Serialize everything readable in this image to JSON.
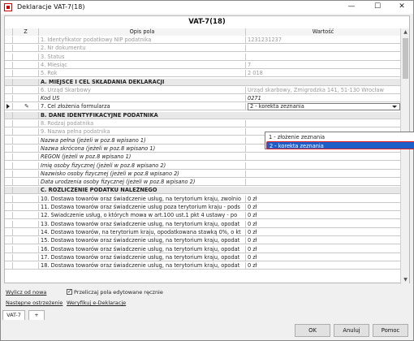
{
  "window": {
    "title": "Deklaracje VAT-7(18)",
    "minimize_label": "—",
    "maximize_label": "☐",
    "close_label": "✕"
  },
  "form": {
    "title": "VAT-7(18)"
  },
  "columns": {
    "z": "Z",
    "description": "Opis pola",
    "value": "Wartość"
  },
  "rows": [
    {
      "kind": "field",
      "label": "1. Identyfikator podatkowy NIP podatnika",
      "value": "1231231237",
      "style": "disabled"
    },
    {
      "kind": "field",
      "label": "2. Nr dokumentu",
      "value": "",
      "style": "disabled"
    },
    {
      "kind": "field",
      "label": "3. Status",
      "value": "",
      "style": "disabled"
    },
    {
      "kind": "field",
      "label": "4. Miesiąc",
      "value": "7",
      "style": "disabled"
    },
    {
      "kind": "field",
      "label": "5. Rok",
      "value": "2 018",
      "style": "disabled"
    },
    {
      "kind": "section",
      "label": "A. MIEJSCE I CEL SKŁADANIA DEKLARACJI"
    },
    {
      "kind": "field",
      "label": "6. Urząd Skarbowy",
      "value": "Urząd skarbowy, Żmigrodzka 141, 51-130 Wrocław",
      "style": "disabled"
    },
    {
      "kind": "field",
      "label": "Kod US",
      "value": "0271",
      "style": "italic"
    },
    {
      "kind": "combo",
      "label": "7. Cel złożenia formularza",
      "value": "2 - korekta zeznania",
      "style": "normal"
    },
    {
      "kind": "section",
      "label": "B. DANE IDENTYFIKACYJNE PODATNIKA"
    },
    {
      "kind": "field",
      "label": "8. Rodzaj podatnika",
      "value": "",
      "style": "disabled"
    },
    {
      "kind": "field",
      "label": "9. Nazwa pełna podatnika",
      "value": "",
      "style": "disabled"
    },
    {
      "kind": "field",
      "label": "Nazwa pełna (jeżeli w poz.8 wpisano 1)",
      "value": "",
      "style": "italic"
    },
    {
      "kind": "field",
      "label": "Nazwa skrócona (jeżeli w poz.8 wpisano 1)",
      "value": "",
      "style": "italic"
    },
    {
      "kind": "field",
      "label": "REGON (jeżeli w poz.8 wpisano 1)",
      "value": "",
      "style": "italic"
    },
    {
      "kind": "field",
      "label": "Imię osoby fizycznej (jeżeli w poz.8 wpisano 2)",
      "value": "",
      "style": "italic"
    },
    {
      "kind": "field",
      "label": "Nazwisko osoby fizycznej (jeżeli w poz.8 wpisano 2)",
      "value": "",
      "style": "italic"
    },
    {
      "kind": "field",
      "label": "Data urodzenia osoby fizycznej (jeżeli w poz.8 wpisano 2)",
      "value": "",
      "style": "italic"
    },
    {
      "kind": "section",
      "label": "C. ROZLICZENIE PODATKU NALEŻNEGO"
    },
    {
      "kind": "field",
      "label": "10. Dostawa towarów oraz świadczenie usług, na terytorium kraju, zwolnio",
      "value": "0 zł",
      "style": "normal"
    },
    {
      "kind": "field",
      "label": "11. Dostawa towarów oraz świadczenie usług poza terytorium kraju - pods",
      "value": "0 zł",
      "style": "normal"
    },
    {
      "kind": "field",
      "label": "12. Świadczenie usług, o których mowa w art.100 ust.1 pkt 4 ustawy - po",
      "value": "0 zł",
      "style": "normal"
    },
    {
      "kind": "field",
      "label": "13. Dostawa towarów oraz świadczenie usług, na terytorium kraju, opodat",
      "value": "0 zł",
      "style": "normal"
    },
    {
      "kind": "field",
      "label": "14. Dostawa towarów, na terytorium kraju, opodatkowana stawką 0%, o kt",
      "value": "0 zł",
      "style": "normal"
    },
    {
      "kind": "field",
      "label": "15. Dostawa towarów oraz świadczenie usług, na terytorium kraju, opodat",
      "value": "0 zł",
      "style": "normal"
    },
    {
      "kind": "field",
      "label": "16. Dostawa towarów oraz świadczenie usług, na terytorium kraju, opodat",
      "value": "0 zł",
      "style": "normal"
    },
    {
      "kind": "field",
      "label": "17. Dostawa towarów oraz świadczenie usług, na terytorium kraju, opodat",
      "value": "0 zł",
      "style": "normal"
    },
    {
      "kind": "field",
      "label": "18. Dostawa towarów oraz świadczenie usług, na terytorium kraju, opodat",
      "value": "0 zł",
      "style": "normal"
    }
  ],
  "dropdown": {
    "options": [
      {
        "label": "1 - złożenie zeznania",
        "selected": false
      },
      {
        "label": "2 - korekta zeznania",
        "selected": true
      }
    ]
  },
  "footer": {
    "clear_link": "Wylicz od nowa",
    "checkbox_label": "Przeliczaj pola edytowane ręcznie",
    "checkbox_checked": true,
    "next_warning_link": "Następne ostrzeżenie",
    "verify_link": "Weryfikuj e-Deklaracje",
    "tabs": [
      "VAT-7",
      "+"
    ],
    "ok_label": "OK",
    "cancel_label": "Anuluj",
    "help_label": "Pomoc"
  },
  "colors": {
    "selection": "#1e5ec9",
    "highlight_border": "#e02020"
  }
}
